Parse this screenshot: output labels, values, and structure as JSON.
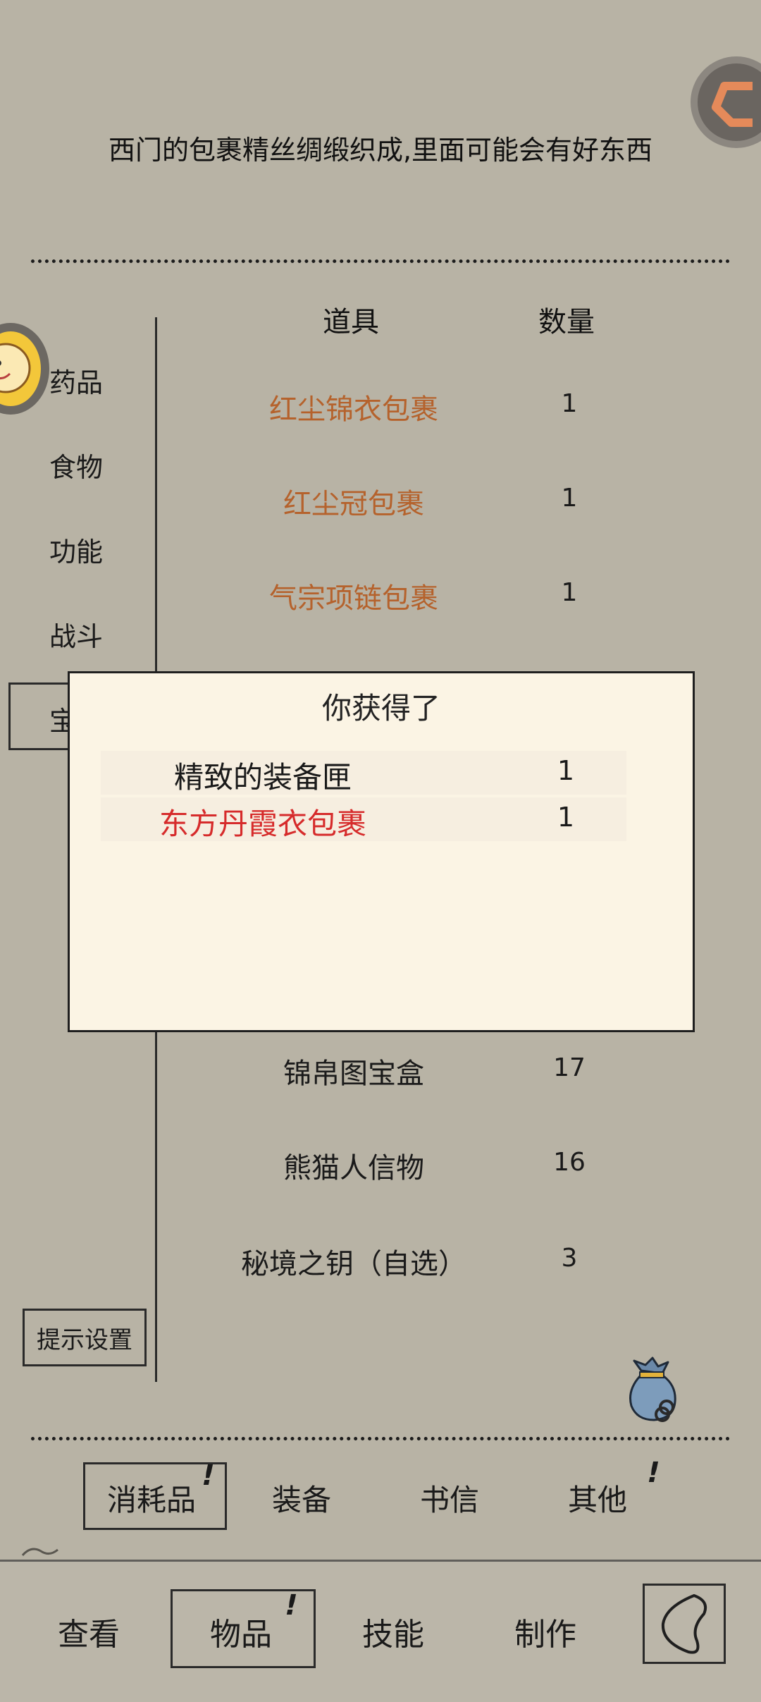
{
  "description": "西门的包裹精丝绸缎织成,里面可能会有好东西",
  "sidebar": {
    "items": [
      {
        "label": "药品"
      },
      {
        "label": "食物"
      },
      {
        "label": "功能"
      },
      {
        "label": "战斗"
      },
      {
        "label": "宝"
      }
    ],
    "hint_button": "提示设置"
  },
  "table": {
    "headers": {
      "item": "道具",
      "qty": "数量"
    },
    "rows": [
      {
        "name": "红尘锦衣包裹",
        "qty": "1",
        "color": "#b5622c"
      },
      {
        "name": "红尘冠包裹",
        "qty": "1",
        "color": "#b5622c"
      },
      {
        "name": "气宗项链包裹",
        "qty": "1",
        "color": "#b5622c"
      },
      {
        "name": "锦帛图宝盒",
        "qty": "17",
        "color": "#1a1a1a"
      },
      {
        "name": "熊猫人信物",
        "qty": "16",
        "color": "#1a1a1a"
      },
      {
        "name": "秘境之钥（自选）",
        "qty": "3",
        "color": "#1a1a1a"
      }
    ]
  },
  "popup": {
    "title": "你获得了",
    "rows": [
      {
        "name": "精致的装备匣",
        "qty": "1",
        "color": "#1a1a1a"
      },
      {
        "name": "东方丹霞衣包裹",
        "qty": "1",
        "color": "#d62b2b"
      }
    ]
  },
  "categories": [
    {
      "label": "消耗品",
      "badge": "!"
    },
    {
      "label": "装备"
    },
    {
      "label": "书信"
    },
    {
      "label": "其他",
      "badge": "!"
    }
  ],
  "bottom_nav": [
    {
      "label": "查看"
    },
    {
      "label": "物品",
      "badge": "!"
    },
    {
      "label": "技能"
    },
    {
      "label": "制作"
    }
  ],
  "icons": {
    "corner": "return-arrow-icon",
    "avatar": "character-avatar-icon",
    "bag": "item-bag-icon",
    "back": "back-arrow-icon"
  }
}
